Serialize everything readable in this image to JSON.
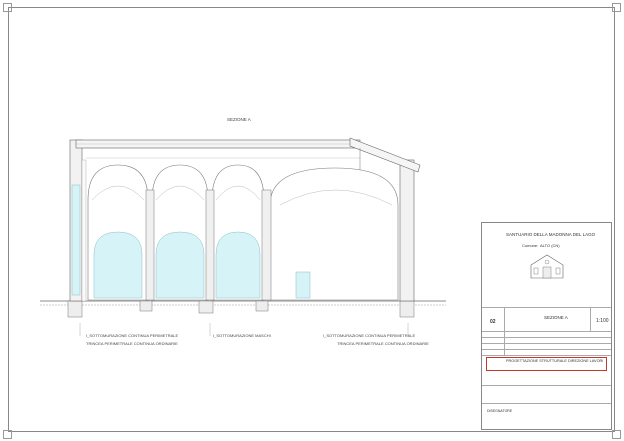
{
  "drawing": {
    "section_title": "SEZIONE A",
    "annotations": [
      "I_SOTTOMURAZIONE CONTINUA PERIMETRALE",
      "TRINCEA PERIMETRALE CONTINUA ORDINARIE",
      "I_SOTTOMURAZIONE MASCHI",
      "I_SOTTOMURAZIONE CONTINUA PERIMETRALE",
      "TRINCEA PERIMETRALE CONTINUA ORDINARIE"
    ]
  },
  "title_block": {
    "project_title": "SANTUARIO DELLA MADONNA DEL LAGO",
    "comune_label": "Comune:",
    "comune_value": "ALTO (CN)",
    "sheet_number": "02",
    "sheet_label": "SEZIONE A",
    "scale": "1:100",
    "company_title": "PROGETTAZIONE STRUTTURALE DIREZIONE LAVORI",
    "drawn_by": "DISEGNATORE",
    "colors": {
      "accent": "#c0392b",
      "glass": "#d6f3f7",
      "line": "#555555"
    }
  }
}
